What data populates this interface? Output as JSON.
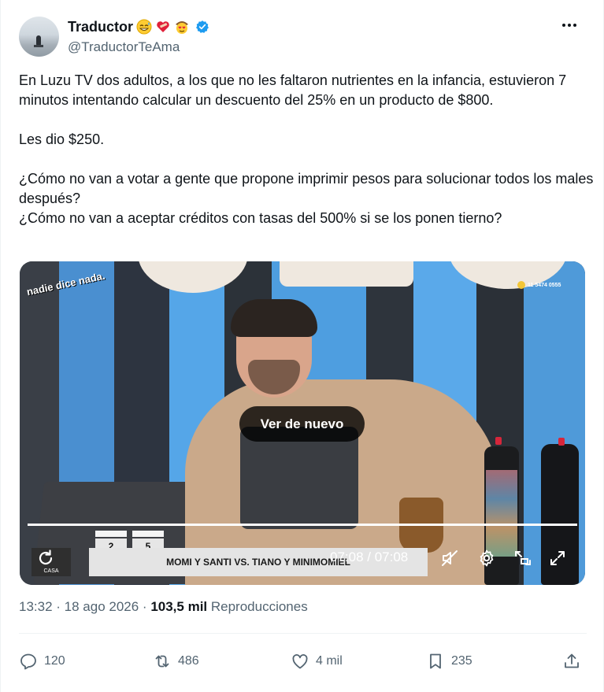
{
  "author": {
    "name": "Traductor",
    "handle": "@TraductorTeAma",
    "verified": true,
    "emoji_icons": [
      "grinning-sweat-face",
      "red-heart-bandage",
      "heart-eyes-cowboy"
    ]
  },
  "tweet": {
    "paragraphs": [
      "En Luzu TV dos adultos, a los que no les faltaron nutrientes en la infancia, estuvieron 7 minutos intentando calcular un descuento del 25% en un producto de $800.",
      "Les dio $250.",
      "¿Cómo no van a votar a gente que propone imprimir pesos para solucionar todos los males después?",
      "¿Cómo no van a aceptar créditos con tasas del 500% si se los ponen tierno?"
    ]
  },
  "video": {
    "replay_label": "Ver de nuevo",
    "timecode": "07:08 / 07:08",
    "progress": 1.0,
    "overlay_logo": "nadie dice nada.",
    "overlay_phone": "11 5474 0555",
    "lower_third": "MOMI Y SANTI VS. TIANO Y MINIMOMIEL",
    "score_left": "2",
    "score_right": "5",
    "side_tag": "CASA",
    "muted": true
  },
  "meta": {
    "time": "13:32",
    "sep1": " · ",
    "date": "18 ago 2026",
    "sep2": " · ",
    "views": "103,5 mil",
    "views_label": " Reproducciones"
  },
  "actions": {
    "replies": "120",
    "reposts": "486",
    "likes": "4 mil",
    "bookmarks": "235"
  },
  "colors": {
    "text": "#0f1419",
    "secondary": "#536471",
    "verified": "#1d9bf0",
    "divider": "#eff3f4"
  }
}
